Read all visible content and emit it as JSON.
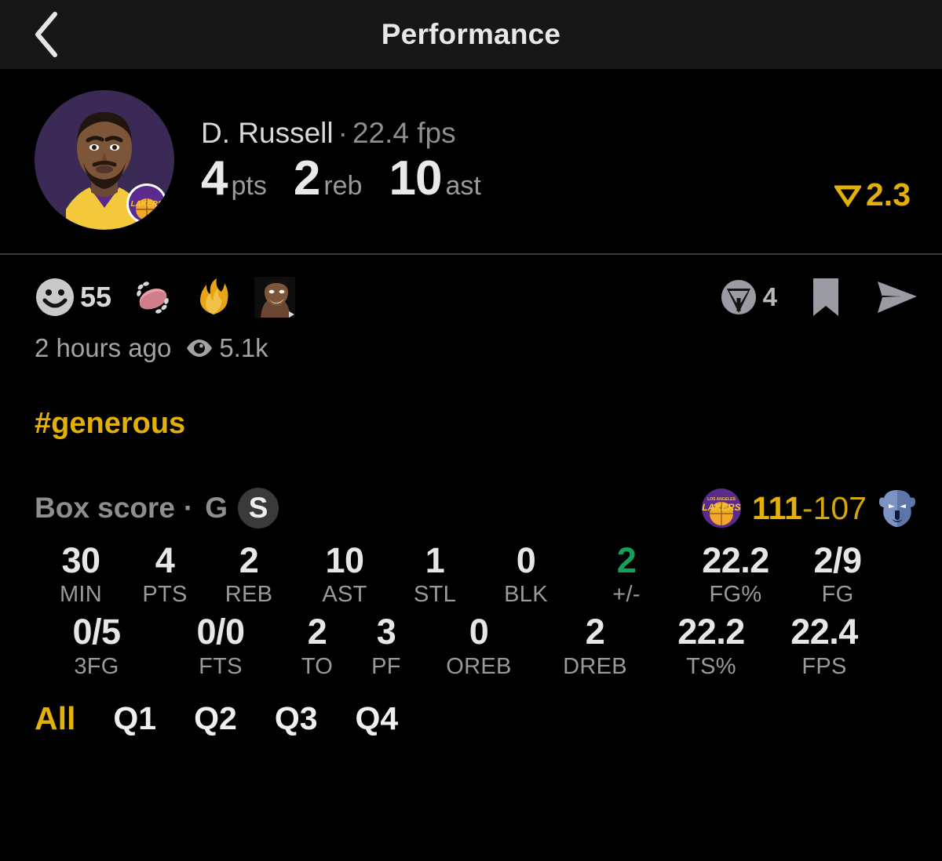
{
  "header": {
    "back_icon": "chevron-left-icon",
    "title": "Performance"
  },
  "player": {
    "avatar_alt": "D. Russell headshot",
    "team_badge": "lakers-logo",
    "name": "D. Russell",
    "separator": "·",
    "fps_text": "22.4 fps",
    "quick_stats": [
      {
        "value": "4",
        "label": "pts"
      },
      {
        "value": "2",
        "label": "reb"
      },
      {
        "value": "10",
        "label": "ast"
      }
    ],
    "rating": {
      "icon": "triangle-down-icon",
      "value": "2.3",
      "color": "#e3b008"
    }
  },
  "social": {
    "reactions": {
      "face_icon": "smiley-face-icon",
      "count": "55",
      "emojis": [
        "clapping-hands-emoji",
        "fire-emoji",
        "custom-face-emoji"
      ]
    },
    "actions": [
      {
        "icon": "comment-circle-icon",
        "count": "4",
        "name": "comment-button"
      },
      {
        "icon": "bookmark-icon",
        "count": "",
        "name": "bookmark-button"
      },
      {
        "icon": "send-icon",
        "count": "",
        "name": "share-button"
      }
    ],
    "timestamp": "2 hours ago",
    "views_icon": "eye-icon",
    "views": "5.1k"
  },
  "hashtag": "#generous",
  "box_score": {
    "title": "Box score",
    "separator": "·",
    "toggle_game": "G",
    "toggle_season": "S",
    "active_toggle": "S",
    "home_logo": "lakers-logo",
    "away_logo": "grizzlies-logo",
    "home_score": "111",
    "score_separator": "-",
    "away_score": "107"
  },
  "stats": {
    "row1": [
      {
        "label": "MIN",
        "value": "30",
        "color": "default"
      },
      {
        "label": "PTS",
        "value": "4",
        "color": "default"
      },
      {
        "label": "REB",
        "value": "2",
        "color": "default"
      },
      {
        "label": "AST",
        "value": "10",
        "color": "default"
      },
      {
        "label": "STL",
        "value": "1",
        "color": "default"
      },
      {
        "label": "BLK",
        "value": "0",
        "color": "default"
      },
      {
        "label": "+/-",
        "value": "2",
        "color": "green"
      },
      {
        "label": "FG%",
        "value": "22.2",
        "color": "default"
      },
      {
        "label": "FG",
        "value": "2/9",
        "color": "default"
      }
    ],
    "row2": [
      {
        "label": "3FG",
        "value": "0/5",
        "color": "default"
      },
      {
        "label": "FTS",
        "value": "0/0",
        "color": "default"
      },
      {
        "label": "TO",
        "value": "2",
        "color": "default"
      },
      {
        "label": "PF",
        "value": "3",
        "color": "default"
      },
      {
        "label": "OREB",
        "value": "0",
        "color": "default"
      },
      {
        "label": "DREB",
        "value": "2",
        "color": "default"
      },
      {
        "label": "TS%",
        "value": "22.2",
        "color": "default"
      },
      {
        "label": "FPS",
        "value": "22.4",
        "color": "default"
      }
    ]
  },
  "quarters": {
    "tabs": [
      "All",
      "Q1",
      "Q2",
      "Q3",
      "Q4"
    ],
    "active": "All"
  },
  "colors": {
    "background": "#000000",
    "header_bg": "#171717",
    "accent_gold": "#e3b008",
    "positive_green": "#13a05c",
    "muted_text": "#9a9a9a",
    "primary_text": "#e6e6e6"
  }
}
